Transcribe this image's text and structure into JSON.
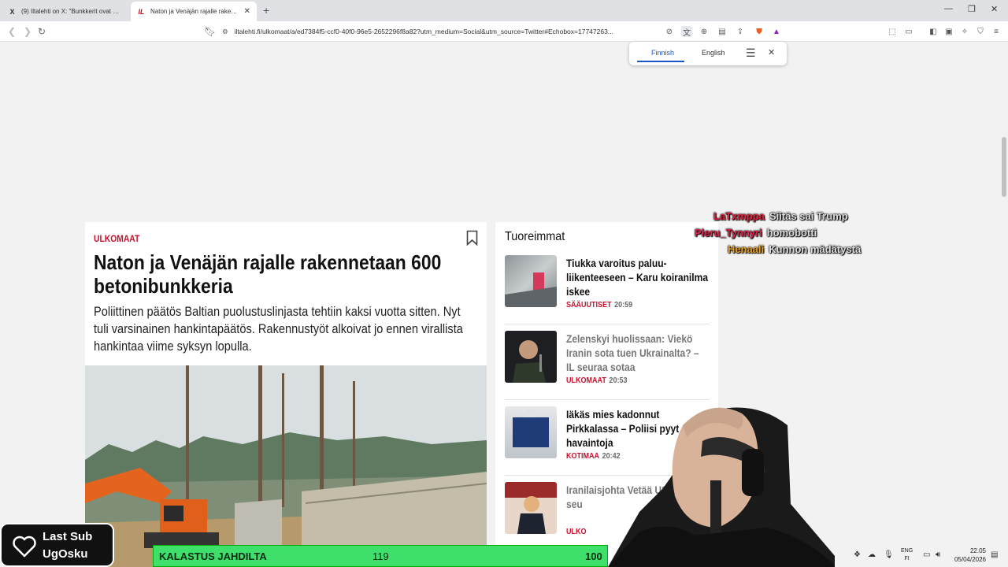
{
  "browser": {
    "tabs": [
      {
        "title": "(9) Iltalehti on X: \"Bunkkerit ovat vai...",
        "favicon": "X",
        "active": false
      },
      {
        "title": "Naton ja Venäjän rajalle rakenne...",
        "favicon": "IL",
        "active": true
      }
    ],
    "url": "iltalehti.fi/ulkomaat/a/ed7384f5-ccf0-40f0-96e5-2652296f8a82?utm_medium=Social&utm_source=Twitter#Echobox=17747263...",
    "icons": [
      "back-icon",
      "forward-icon",
      "reload-icon",
      "bookmark-icon",
      "site-info-icon",
      "translate-icon",
      "zoom-icon",
      "reader-icon",
      "share-icon",
      "brave-shield-icon",
      "rewards-icon",
      "extensions-icon",
      "sidebar-icon",
      "wallet-icon",
      "leo-icon",
      "vpn-icon",
      "menu-icon"
    ]
  },
  "translate_popup": {
    "languages": [
      "Finnish",
      "English"
    ],
    "selected": "Finnish"
  },
  "article": {
    "category": "ULKOMAAT",
    "headline": "Naton ja Venäjän rajalle rakennetaan 600 betonibunkkeria",
    "lead": "Poliittinen päätös Baltian puolustuslinjasta tehtiin kaksi vuotta sitten. Nyt tuli varsinainen hankintapäätös. Rakennustyöt alkoivat jo ennen virallista hankintaa viime syksyn lopulla."
  },
  "sidebar": {
    "title": "Tuoreimmat",
    "items": [
      {
        "headline": "Tiukka varoitus paluu-liikenteeseen – Karu koiranilma iskee",
        "category": "SÄÄUUTISET",
        "time": "20:59",
        "read": false
      },
      {
        "headline": "Zelenskyi huolissaan: Viekö Iranin sota tuen Ukrainalta? – IL seuraa sotaa",
        "category": "ULKOMAAT",
        "time": "20:53",
        "read": true
      },
      {
        "headline": "Iäkäs mies kadonnut Pirkkalassa – Poliisi pyyt havaintoja",
        "category": "KOTIMAA",
        "time": "20:42",
        "read": false
      },
      {
        "headline": "Iranilaisjohta Vetää USA – IL seu",
        "category": "ULKO",
        "time": "",
        "read": true
      }
    ]
  },
  "chat": [
    {
      "user": "LaTxmppa",
      "message": "Siitäs sai Trump",
      "color": "#e8203a"
    },
    {
      "user": "Pieru_Tynnyri",
      "message": "homobotti",
      "color": "#e0204a"
    },
    {
      "user": "Henaali",
      "message": "Kunnon mädätystä",
      "color": "#e8a020"
    }
  ],
  "last_sub": {
    "label": "Last Sub",
    "name": "UgOsku"
  },
  "kalastus": {
    "title": "KALASTUS JAHDILTA",
    "value1": "119",
    "value2": "100"
  },
  "tray": {
    "lang_line1": "ENG",
    "lang_line2": "FI",
    "time": "22.05",
    "date": "05/04/2026"
  }
}
